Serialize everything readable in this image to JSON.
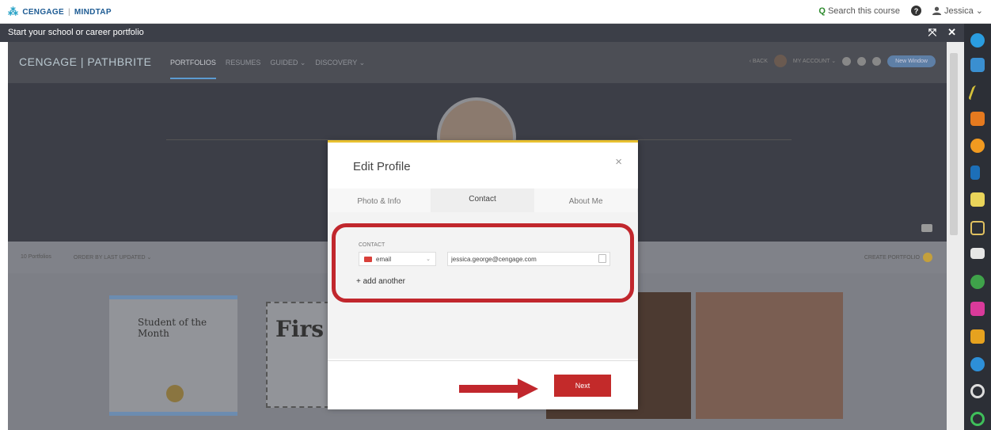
{
  "topbar": {
    "logo_left": "CENGAGE",
    "logo_right": "MINDTAP",
    "search_label": "Search this course",
    "help_glyph": "?",
    "user_name": "Jessica ⌄"
  },
  "panel": {
    "title": "Start your school or career portfolio",
    "ctrl_expand": "⤧",
    "ctrl_close": "✕"
  },
  "portfolio_nav": {
    "brand": "CENGAGE | PATHBRITE",
    "links": [
      "PORTFOLIOS",
      "RESUMES",
      "GUIDED ⌄",
      "DISCOVERY ⌄"
    ],
    "back": "‹ BACK",
    "my_account": "MY ACCOUNT ⌄",
    "new_window": "New Window"
  },
  "list_bar": {
    "count": "10 Portfolios",
    "order": "ORDER BY LAST UPDATED ⌄",
    "create": "CREATE PORTFOLIO"
  },
  "cards": {
    "cert1_title": "Student of the Month",
    "cert2_title": "Firs"
  },
  "modal": {
    "title": "Edit Profile",
    "close_glyph": "×",
    "tabs": [
      "Photo & Info",
      "Contact",
      "About Me"
    ],
    "active_tab": "Contact",
    "contact_label": "CONTACT",
    "contact_type": "email",
    "select_arrow": "⌄",
    "email_value": "jessica.george@cengage.com",
    "add_another": "+ add another",
    "next_label": "Next"
  },
  "colors": {
    "highlight": "#c1272d",
    "next_button": "#c32a2a",
    "modal_top_border": "#e8c030"
  }
}
